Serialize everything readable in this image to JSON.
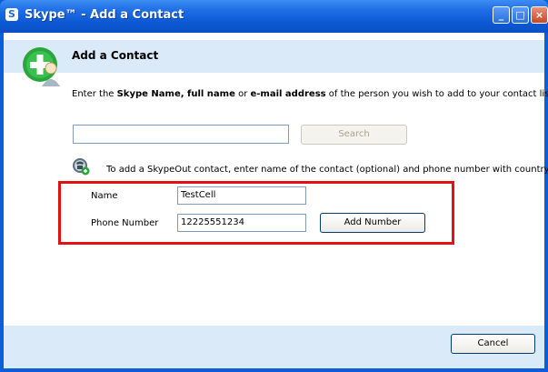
{
  "window": {
    "title": "Skype™ - Add a Contact",
    "logo_glyph": "S",
    "minimize_glyph": "_",
    "maximize_glyph": "□",
    "close_glyph": "×"
  },
  "header": {
    "title": "Add a Contact",
    "icon": "add-contact-icon"
  },
  "intro": {
    "prefix": "Enter the ",
    "bold1": "Skype Name, full name",
    "middle": " or ",
    "bold2": "e-mail address",
    "suffix": " of the person you wish to add to your contact list."
  },
  "search": {
    "value": "",
    "button_label": "Search",
    "button_enabled": false
  },
  "skypeout": {
    "icon": "skypeout-phone-icon",
    "text": "To add a SkypeOut contact, enter name of the contact (optional) and phone number with country code"
  },
  "form": {
    "name_label": "Name",
    "name_value": "TestCell",
    "phone_label": "Phone Number",
    "phone_value": "12225551234",
    "add_number_label": "Add Number"
  },
  "footer": {
    "cancel_label": "Cancel"
  },
  "colors": {
    "title_bar": "#0c58d4",
    "header_band": "#dbeaf9",
    "highlight": "#e31212",
    "icon_green": "#2aa63c"
  }
}
